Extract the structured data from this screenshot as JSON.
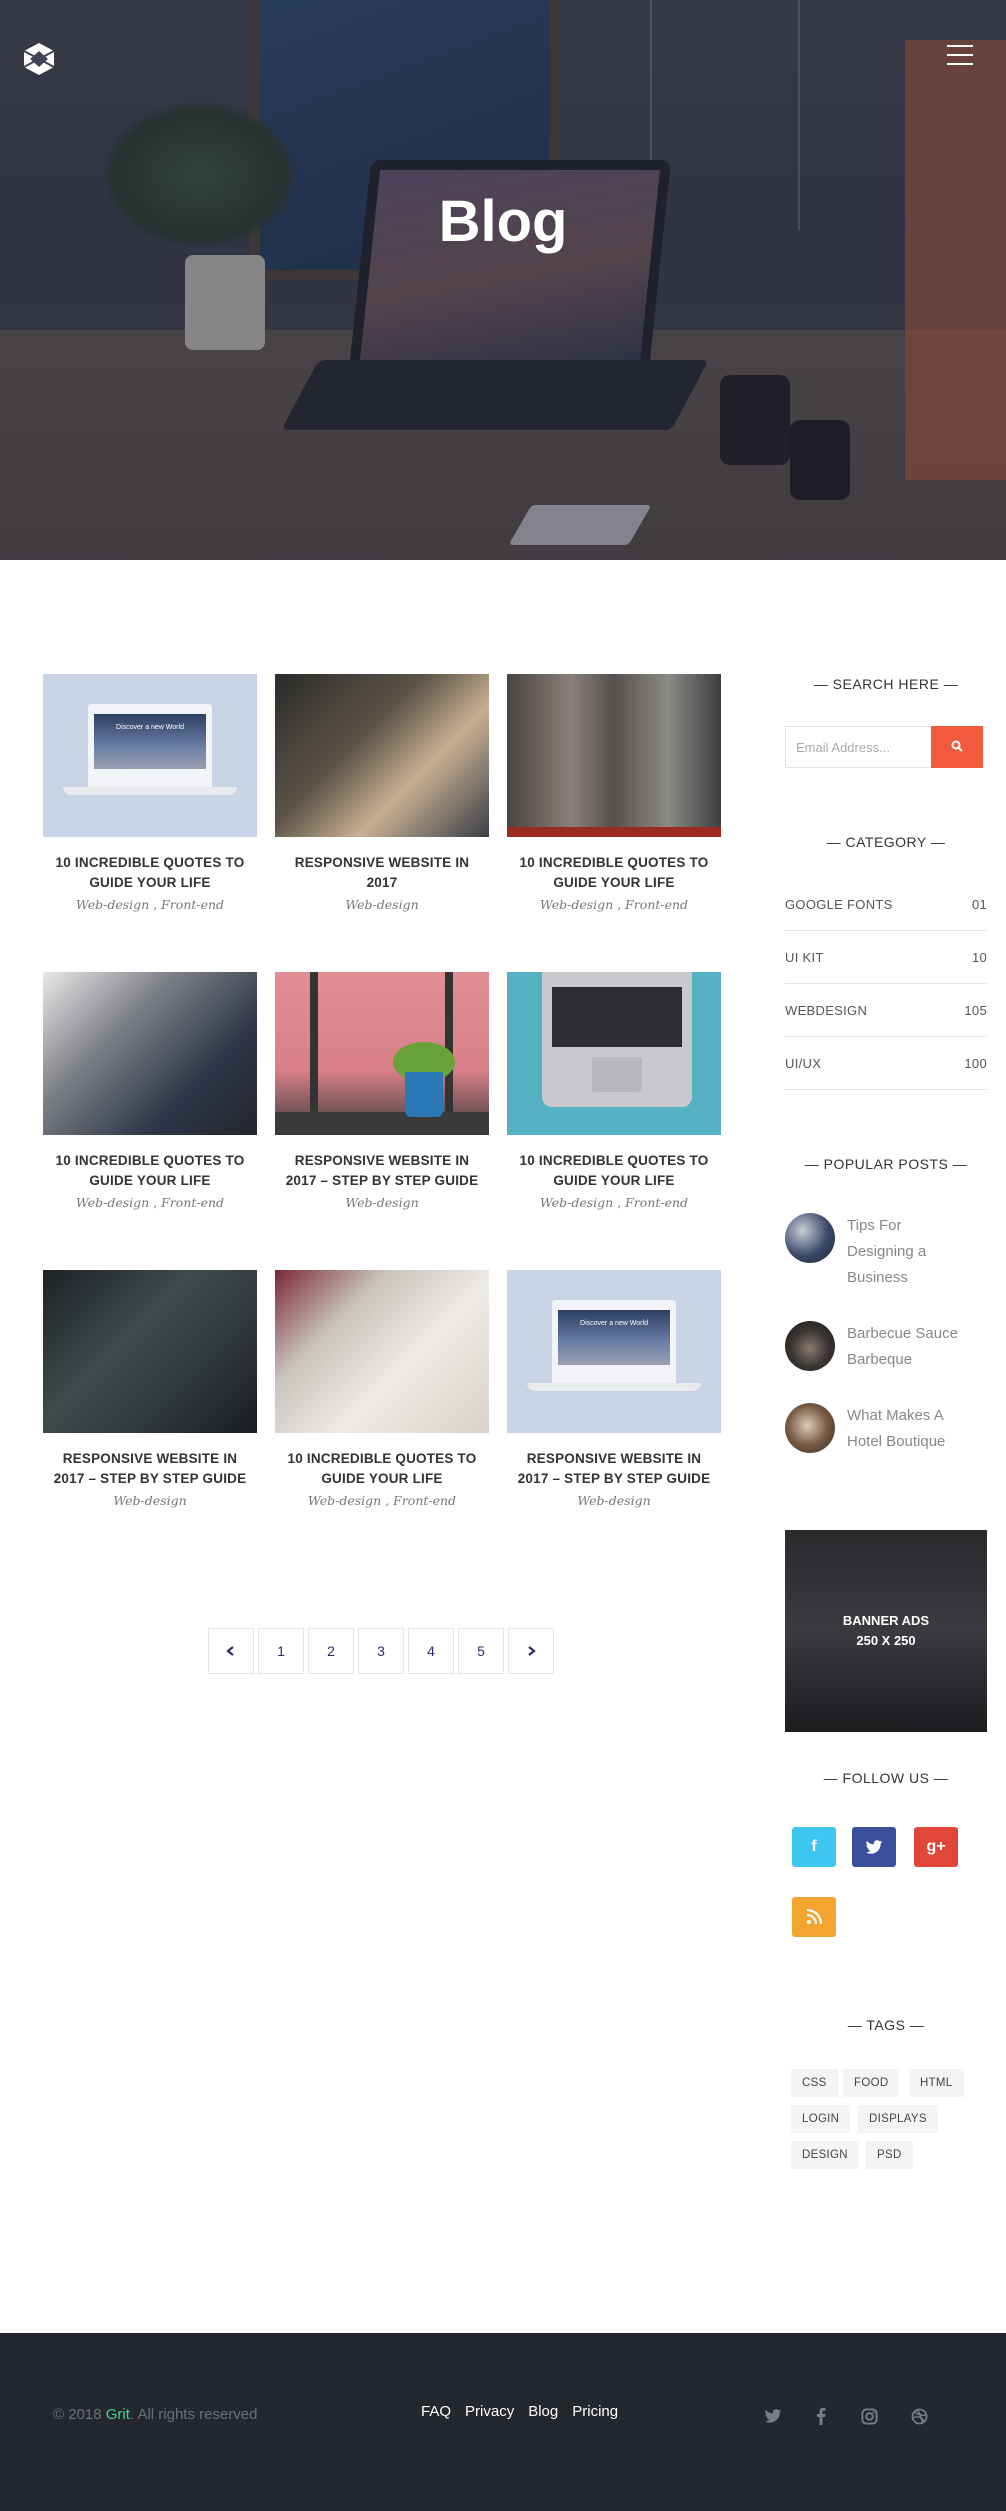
{
  "hero": {
    "title": "Blog"
  },
  "posts": [
    {
      "title": "10 INCREDIBLE QUOTES TO GUIDE YOUR LIFE",
      "category": "Web-design , Front-end",
      "thumb_text": "Discover a new World"
    },
    {
      "title": "RESPONSIVE WEBSITE IN 2017",
      "category": "Web-design"
    },
    {
      "title": "10 INCREDIBLE QUOTES TO GUIDE YOUR LIFE",
      "category": "Web-design , Front-end"
    },
    {
      "title": "10 INCREDIBLE QUOTES TO GUIDE YOUR LIFE",
      "category": "Web-design , Front-end"
    },
    {
      "title": "RESPONSIVE WEBSITE IN 2017 – STEP BY STEP GUIDE",
      "category": "Web-design"
    },
    {
      "title": "10 INCREDIBLE QUOTES TO GUIDE YOUR LIFE",
      "category": "Web-design , Front-end"
    },
    {
      "title": "RESPONSIVE WEBSITE IN 2017 – STEP BY STEP GUIDE",
      "category": "Web-design"
    },
    {
      "title": "10 INCREDIBLE QUOTES TO GUIDE YOUR LIFE",
      "category": "Web-design , Front-end"
    },
    {
      "title": "RESPONSIVE WEBSITE IN 2017 – STEP BY STEP GUIDE",
      "category": "Web-design",
      "thumb_text": "Discover a new World"
    }
  ],
  "pagination": {
    "prev_icon": "chevron-left-icon",
    "pages": [
      "1",
      "2",
      "3",
      "4",
      "5"
    ],
    "next_icon": "chevron-right-icon"
  },
  "sidebar": {
    "search": {
      "heading": "— SEARCH HERE —",
      "placeholder": "Email Address...",
      "button_icon": "search-icon",
      "button_color": "#f15a3c"
    },
    "category": {
      "heading": "— CATEGORY —",
      "items": [
        {
          "label": "GOOGLE FONTS",
          "count": "01"
        },
        {
          "label": "UI KIT",
          "count": "10"
        },
        {
          "label": "WEBDESIGN",
          "count": "105"
        },
        {
          "label": "UI/UX",
          "count": "100"
        }
      ]
    },
    "popular": {
      "heading": "— POPULAR POSTS —",
      "items": [
        {
          "title_line1": "Tips For",
          "title_line2": "Designing a",
          "title_line3": "Business"
        },
        {
          "title_line1": "Barbecue Sauce",
          "title_line2": "Barbeque"
        },
        {
          "title_line1": "What Makes A",
          "title_line2": "Hotel Boutique"
        }
      ]
    },
    "banner": {
      "line1": "BANNER ADS",
      "line2": "250 X 250"
    },
    "follow": {
      "heading": "— FOLLOW US —",
      "items": [
        {
          "icon": "facebook-icon",
          "glyph": "f",
          "color": "#3ec6f0"
        },
        {
          "icon": "twitter-icon",
          "glyph": "t",
          "color": "#3b4f9c"
        },
        {
          "icon": "google-plus-icon",
          "glyph": "g+",
          "color": "#e0463a"
        },
        {
          "icon": "rss-icon",
          "glyph": "rss",
          "color": "#f3a530"
        }
      ]
    },
    "tags": {
      "heading": "— TAGS —",
      "items": [
        "CSS",
        "FOOD",
        "HTML",
        "LOGIN",
        "DISPLAYS",
        "DESIGN",
        "PSD"
      ]
    }
  },
  "footer": {
    "copyright_prefix": "© 2018 ",
    "brand": "Grit",
    "copyright_suffix": ". All rights reserved",
    "brand_color": "#3fd38f",
    "links": [
      "FAQ",
      "Privacy",
      "Blog",
      "Pricing"
    ],
    "social_icons": [
      "twitter-icon",
      "facebook-icon",
      "instagram-icon",
      "dribbble-icon"
    ]
  }
}
